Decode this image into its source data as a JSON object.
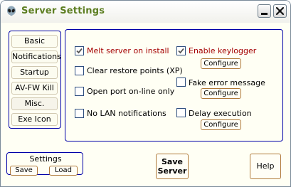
{
  "window": {
    "title": "Server Settings",
    "app_icon": "alien-head-icon",
    "accent_color": "#5d7e22",
    "border_color": "#0000a8"
  },
  "nav": {
    "items": [
      {
        "label": "Basic"
      },
      {
        "label": "Notifications"
      },
      {
        "label": "Startup"
      },
      {
        "label": "AV-FW Kill"
      },
      {
        "label": "Misc.",
        "active": true
      },
      {
        "label": "Exe Icon"
      }
    ]
  },
  "options": {
    "melt": {
      "label": "Melt server on install",
      "checked": true
    },
    "restore": {
      "label": "Clear restore points (XP)",
      "checked": false
    },
    "port": {
      "label": "Open port on-line only",
      "checked": false
    },
    "lan": {
      "label": "No LAN notifications",
      "checked": false
    },
    "keylogger": {
      "label": "Enable keylogger",
      "checked": true,
      "configure": "Configure"
    },
    "fake_error": {
      "label": "Fake error message",
      "checked": false,
      "configure": "Configure"
    },
    "delay": {
      "label": "Delay execution",
      "checked": false,
      "configure": "Configure"
    }
  },
  "settings": {
    "title": "Settings",
    "save": "Save",
    "load": "Load"
  },
  "save_server": {
    "line1": "Save",
    "line2": "Server"
  },
  "help": "Help"
}
